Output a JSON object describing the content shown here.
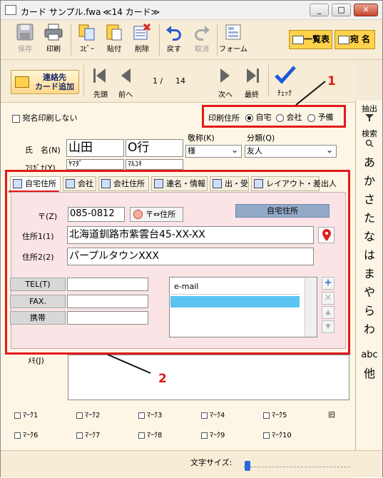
{
  "window": {
    "title": "カード サンプル.fwa",
    "card_count": "≪14 カード≫",
    "min_label": "_",
    "max_label": "□",
    "close_label": "✕"
  },
  "toolbar": {
    "save": "保存",
    "print": "印刷",
    "copy": "ｺﾋﾟｰ",
    "paste": "貼付",
    "delete": "削除",
    "undo": "戻す",
    "redo": "取消",
    "form": "フォーム",
    "list_button": "一覧表",
    "address_button": "宛 名"
  },
  "navbar": {
    "add_card_line1": "連絡先",
    "add_card_line2": "カード追加",
    "first": "先頭",
    "prev": "前へ",
    "position": "1 /",
    "total": "14",
    "next": "次へ",
    "last": "最終",
    "check": "ﾁｪｯｸ"
  },
  "sidebar": {
    "extract": "抽出",
    "search": "検索",
    "kana": [
      "あ",
      "か",
      "さ",
      "た",
      "な",
      "は",
      "ま",
      "や",
      "ら",
      "わ"
    ],
    "abc": "abc",
    "other": "他"
  },
  "form": {
    "no_address_print": "宛名印刷しない",
    "print_address_label": "印刷住所",
    "print_options": [
      "自宅",
      "会社",
      "予備"
    ],
    "print_selected": "自宅",
    "name_label": "氏　名(N)",
    "last_name": "山田",
    "first_name": "O行",
    "furigana_label": "ﾌﾘｶﾞﾅ(Y)",
    "last_kana": "ﾔﾏﾀﾞ",
    "first_kana": "ﾏﾙﾕｷ",
    "honorific_label": "敬称(K)",
    "honorific_value": "様",
    "category_label": "分類(Q)",
    "category_value": "友人"
  },
  "tabs": [
    "自宅住所",
    "会社",
    "会社住所",
    "連名・情報",
    "出・受",
    "レイアウト・差出人"
  ],
  "home": {
    "postal_label": "〒(Z)",
    "postal_value": "085-0812",
    "zip_address_button": "〒⇔住所",
    "badge": "自宅住所",
    "address1_label": "住所1(1)",
    "address1_value": "北海道釧路市紫雲台45-XX-XX",
    "address2_label": "住所2(2)",
    "address2_value": "パープルタウンXXX",
    "tel_label": "TEL(T)",
    "fax_label": "FAX.",
    "mobile_label": "携帯",
    "email_header": "e-mail"
  },
  "memo_label": "ﾒﾓ(J)",
  "marks": [
    "ﾏｰｸ1",
    "ﾏｰｸ2",
    "ﾏｰｸ3",
    "ﾏｰｸ4",
    "ﾏｰｸ5",
    "ﾏｰｸ6",
    "ﾏｰｸ7",
    "ﾏｰｸ8",
    "ﾏｰｸ9",
    "ﾏｰｸ10"
  ],
  "marks_extra": "旧",
  "footer": {
    "font_size_label": "文字サイズ:"
  },
  "callouts": {
    "one": "1",
    "two": "2"
  },
  "colors": {
    "accent_red": "#e11a1a",
    "panel_pink": "#fbe4e6",
    "yellow_button": "#ffd24a",
    "selection_blue": "#5bc3f0"
  }
}
